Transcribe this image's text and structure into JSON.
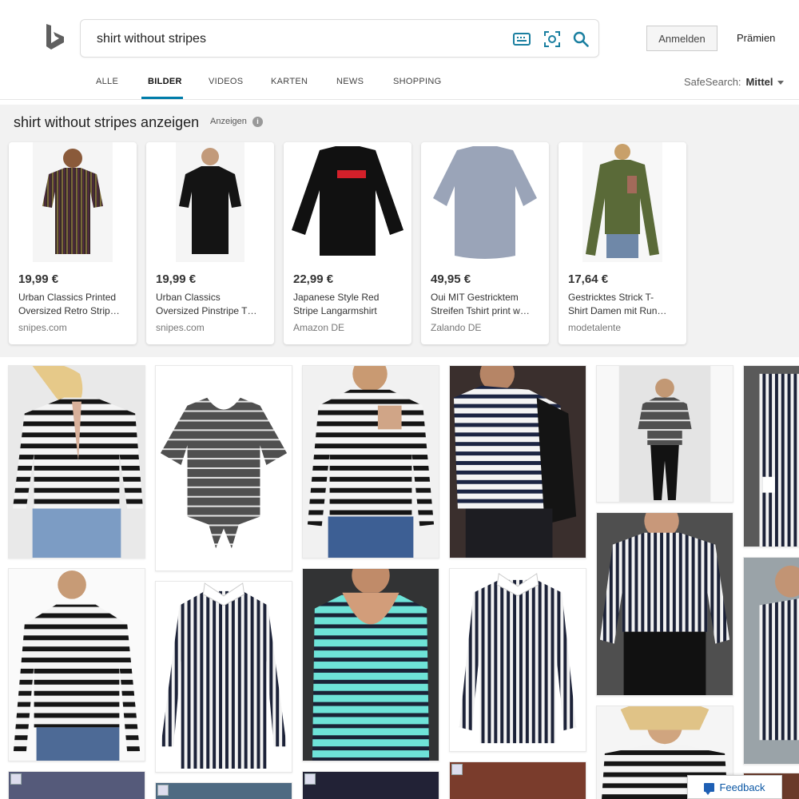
{
  "search": {
    "query": "shirt without stripes"
  },
  "header": {
    "signin_label": "Anmelden",
    "rewards_label": "Prämien"
  },
  "tabs": [
    {
      "label": "ALLE"
    },
    {
      "label": "BILDER",
      "active": true
    },
    {
      "label": "VIDEOS"
    },
    {
      "label": "KARTEN"
    },
    {
      "label": "NEWS"
    },
    {
      "label": "SHOPPING"
    }
  ],
  "safesearch": {
    "label": "SafeSearch:",
    "value": "Mittel"
  },
  "ads": {
    "title": "shirt without stripes anzeigen",
    "sponsored_label": "Anzeigen",
    "items": [
      {
        "price": "19,99 €",
        "name_line1": "Urban Classics Printed",
        "name_line2": "Oversized Retro Strip…",
        "store": "snipes.com"
      },
      {
        "price": "19,99 €",
        "name_line1": "Urban Classics",
        "name_line2": "Oversized Pinstripe T…",
        "store": "snipes.com"
      },
      {
        "price": "22,99 €",
        "name_line1": "Japanese Style Red",
        "name_line2": "Stripe Langarmshirt",
        "store": "Amazon DE"
      },
      {
        "price": "49,95 €",
        "name_line1": "Oui MIT Gestricktem",
        "name_line2": "Streifen Tshirt print w…",
        "store": "Zalando DE"
      },
      {
        "price": "17,64 €",
        "name_line1": "Gestricktes Strick T-",
        "name_line2": "Shirt Damen mit Run…",
        "store": "modetalente"
      }
    ]
  },
  "feedback": {
    "label": "Feedback"
  },
  "colors": {
    "accent": "#007daa",
    "search_icon": "#1a7fa0",
    "ads_bg": "#f2f2f2"
  },
  "icons": [
    "bing-logo-icon",
    "keyboard-icon",
    "visual-search-icon",
    "search-icon",
    "info-icon",
    "chevron-down-icon",
    "feedback-icon"
  ]
}
